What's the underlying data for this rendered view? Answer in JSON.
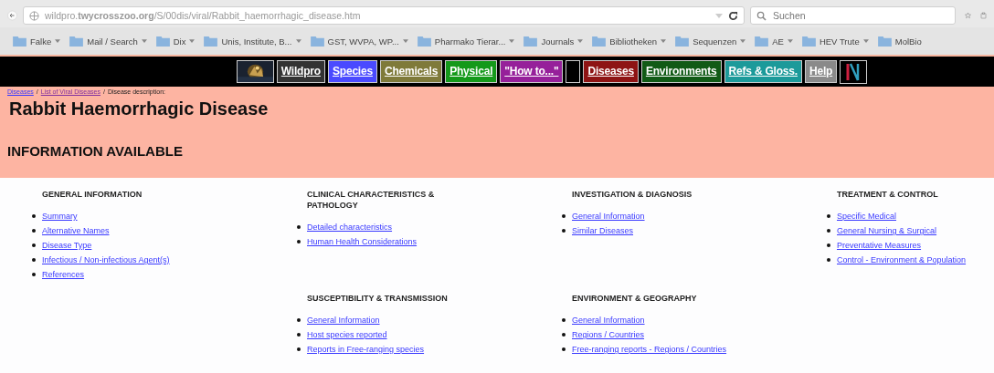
{
  "browser": {
    "url": "wildpro.**twycrosszoo.org**/S/00dis/viral/Rabbit_haemorrhagic_disease.htm",
    "search": {
      "placeholder": "Suchen"
    }
  },
  "bookmarks": [
    {
      "label": "Falke",
      "menu": true
    },
    {
      "label": "Mail / Search",
      "menu": true
    },
    {
      "label": "Dix",
      "menu": true
    },
    {
      "label": "Unis, Institute, B...",
      "menu": true
    },
    {
      "label": "GST, WVPA, WP...",
      "menu": true
    },
    {
      "label": "Pharmako Tierar...",
      "menu": true
    },
    {
      "label": "Journals",
      "menu": true
    },
    {
      "label": "Bibliotheken",
      "menu": true
    },
    {
      "label": "Sequenzen",
      "menu": true
    },
    {
      "label": "AE",
      "menu": true
    },
    {
      "label": "HEV Trute",
      "menu": true
    },
    {
      "label": "MolBio",
      "menu": false
    }
  ],
  "nav": [
    {
      "kind": "picture"
    },
    {
      "kind": "link",
      "label": "Wildpro",
      "color": "#333333"
    },
    {
      "kind": "link",
      "label": "Species",
      "color": "#4a4aff"
    },
    {
      "kind": "link",
      "label": "Chemicals",
      "color": "#7f7a3a"
    },
    {
      "kind": "link",
      "label": "Physical",
      "color": "#14991a"
    },
    {
      "kind": "link",
      "label": "\"How to...\"",
      "color": "#96209a"
    },
    {
      "kind": "blank"
    },
    {
      "kind": "link",
      "label": "Diseases",
      "color": "#8e1414"
    },
    {
      "kind": "link",
      "label": "Environments",
      "color": "#115a16"
    },
    {
      "kind": "link",
      "label": "Refs & Gloss.",
      "color": "#1c9a9a"
    },
    {
      "kind": "link",
      "label": "Help",
      "color": "#8a8a8a"
    },
    {
      "kind": "logo"
    }
  ],
  "breadcrumb": [
    {
      "label": "Diseases",
      "link": true,
      "visited": false
    },
    {
      "separator": "/",
      "label": "List of Viral Diseases",
      "link": true,
      "visited": true
    },
    {
      "separator": "/",
      "label": "Disease description:",
      "link": false
    }
  ],
  "title": "Rabbit Haemorrhagic Disease",
  "subtitle": "INFORMATION AVAILABLE",
  "sections": [
    {
      "title": "GENERAL INFORMATION",
      "links": [
        "Summary",
        "Alternative Names",
        "Disease Type",
        "Infectious / Non-infectious Agent(s)",
        "References"
      ]
    },
    {
      "title": "CLINICAL CHARACTERISTICS & PATHOLOGY",
      "links": [
        "Detailed characteristics",
        "Human Health Considerations"
      ]
    },
    {
      "title": "INVESTIGATION & DIAGNOSIS",
      "links": [
        "General Information",
        "Similar Diseases"
      ]
    },
    {
      "title": "TREATMENT & CONTROL",
      "links": [
        "Specific Medical",
        "General Nursing & Surgical",
        "Preventative Measures",
        "Control - Environment & Population"
      ]
    },
    {
      "title": "SUSCEPTIBILITY & TRANSMISSION",
      "links": [
        "General Information",
        "Host species reported",
        "Reports in Free-ranging species"
      ]
    },
    {
      "title": "ENVIRONMENT & GEOGRAPHY",
      "links": [
        "General Information",
        "Regions / Countries",
        "Free-ranging reports - Regions / Countries"
      ]
    }
  ]
}
